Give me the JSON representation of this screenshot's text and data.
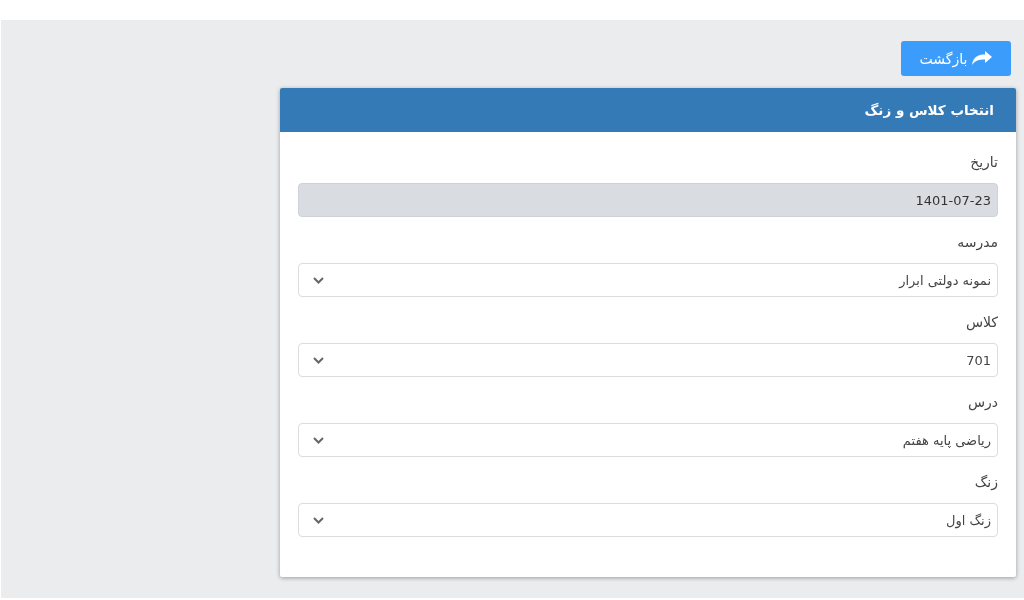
{
  "back_button": {
    "label": "بازگشت"
  },
  "panel": {
    "title": "انتخاب کلاس و زنگ"
  },
  "fields": [
    {
      "label": "تاریخ",
      "kind": "input",
      "value": "1401-07-23",
      "disabled": true
    },
    {
      "label": "مدرسه",
      "kind": "select",
      "value": "نمونه دولتی ابرار",
      "disabled": false
    },
    {
      "label": "کلاس",
      "kind": "select",
      "value": "701",
      "disabled": false
    },
    {
      "label": "درس",
      "kind": "select",
      "value": "ریاضی پایه هفتم",
      "disabled": false
    },
    {
      "label": "زنگ",
      "kind": "select",
      "value": "زنگ اول",
      "disabled": false
    }
  ]
}
